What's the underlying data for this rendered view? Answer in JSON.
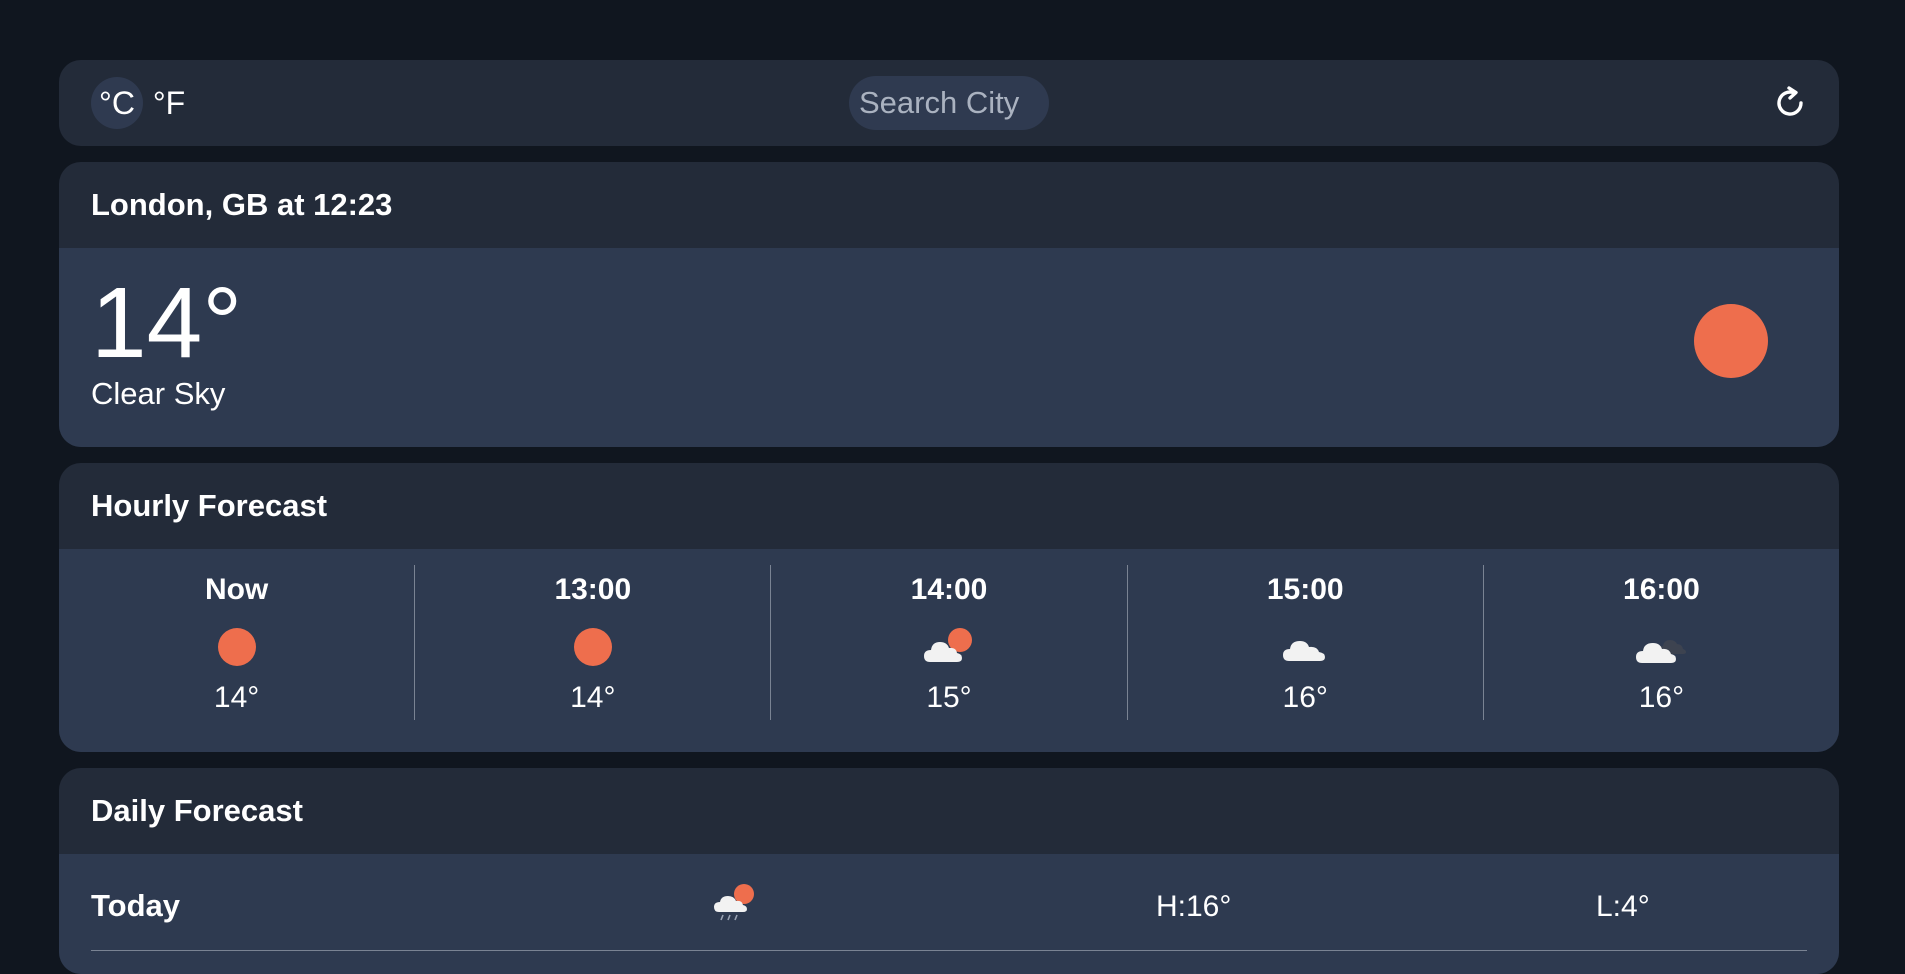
{
  "units": {
    "celsius": "°C",
    "fahrenheit": "°F",
    "active": "celsius"
  },
  "search": {
    "placeholder": "Search City"
  },
  "refresh": {
    "icon": "refresh-icon",
    "glyph": "↻"
  },
  "current": {
    "title": "London, GB at 12:23",
    "temp": "14°",
    "description": "Clear Sky",
    "icon": "sun-icon"
  },
  "hourly": {
    "title": "Hourly Forecast",
    "items": [
      {
        "label": "Now",
        "icon": "sun-icon",
        "temp": "14°"
      },
      {
        "label": "13:00",
        "icon": "sun-icon",
        "temp": "14°"
      },
      {
        "label": "14:00",
        "icon": "partly-cloudy-icon",
        "temp": "15°"
      },
      {
        "label": "15:00",
        "icon": "cloud-icon",
        "temp": "16°"
      },
      {
        "label": "16:00",
        "icon": "broken-clouds-icon",
        "temp": "16°"
      }
    ]
  },
  "daily": {
    "title": "Daily Forecast",
    "items": [
      {
        "label": "Today",
        "icon": "rain-sun-icon",
        "high": "H:16°",
        "low": "L:4°"
      }
    ]
  },
  "colors": {
    "background": "#10161f",
    "card": "#232b39",
    "card_body": "#2e3a50",
    "sun": "#ee6e4d",
    "cloud": "#f2f2f2",
    "dark_cloud": "#3d4350"
  }
}
